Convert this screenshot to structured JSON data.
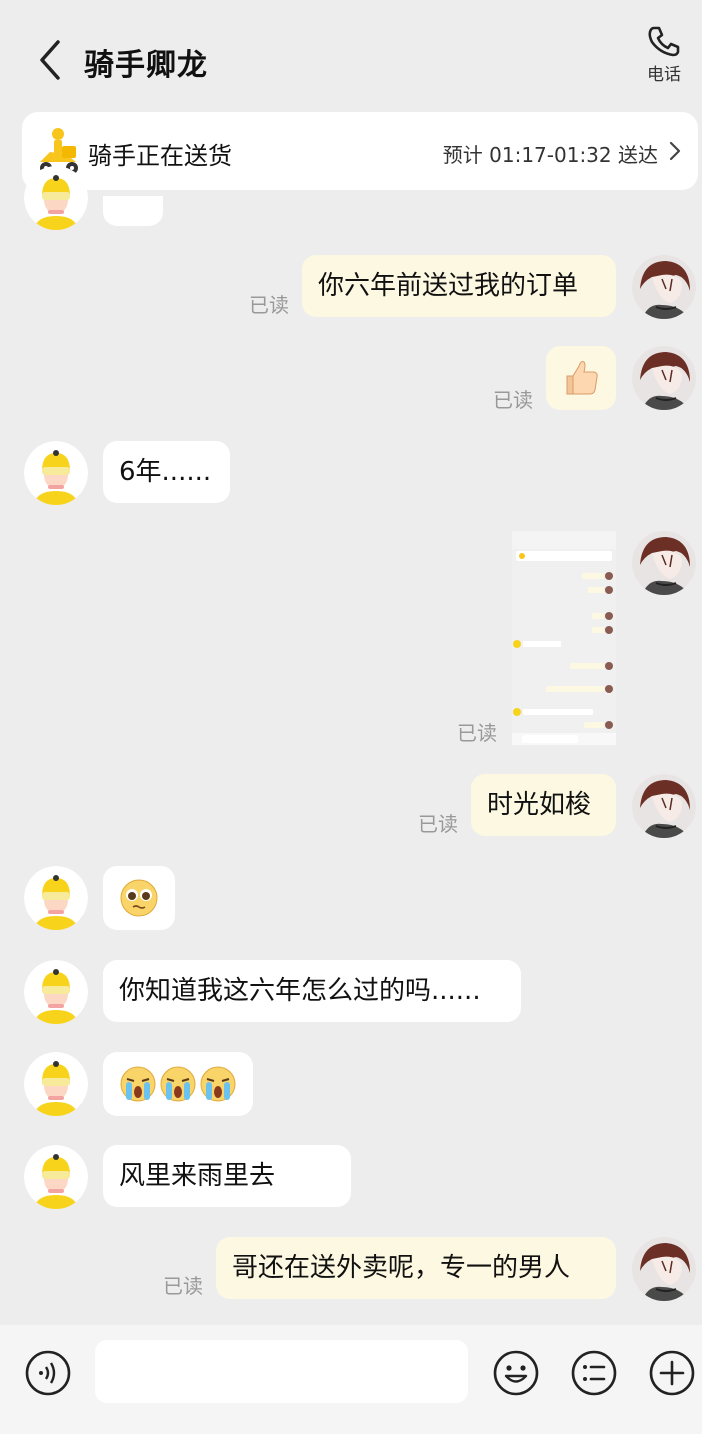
{
  "header": {
    "title": "骑手卿龙",
    "phone_label": "电话"
  },
  "status": {
    "text": "骑手正在送货",
    "eta": "预计 01:17-01:32 送达"
  },
  "messages": [
    {
      "side": "out",
      "text": "你六年前送过我的订单",
      "read": "已读"
    },
    {
      "side": "out",
      "sticker": "thumbs-up-emoji",
      "read": "已读"
    },
    {
      "side": "in",
      "text": "6年......"
    },
    {
      "side": "out",
      "image": "chat-screenshot-image",
      "read": "已读"
    },
    {
      "side": "out",
      "text": "时光如梭",
      "read": "已读"
    },
    {
      "side": "in",
      "sticker": "pleading-face-emoji"
    },
    {
      "side": "in",
      "text": "你知道我这六年怎么过的吗......"
    },
    {
      "side": "in",
      "sticker": "crying-face-emoji-x3"
    },
    {
      "side": "in",
      "text": "风里来雨里去"
    },
    {
      "side": "out",
      "text": "哥还在送外卖呢，专一的男人",
      "read": "已读"
    }
  ],
  "input": {
    "placeholder": ""
  },
  "colors": {
    "background": "#ededed",
    "outgoing_bubble": "#fdf8e2",
    "incoming_bubble": "#ffffff",
    "rider_yellow": "#f7d31c"
  }
}
